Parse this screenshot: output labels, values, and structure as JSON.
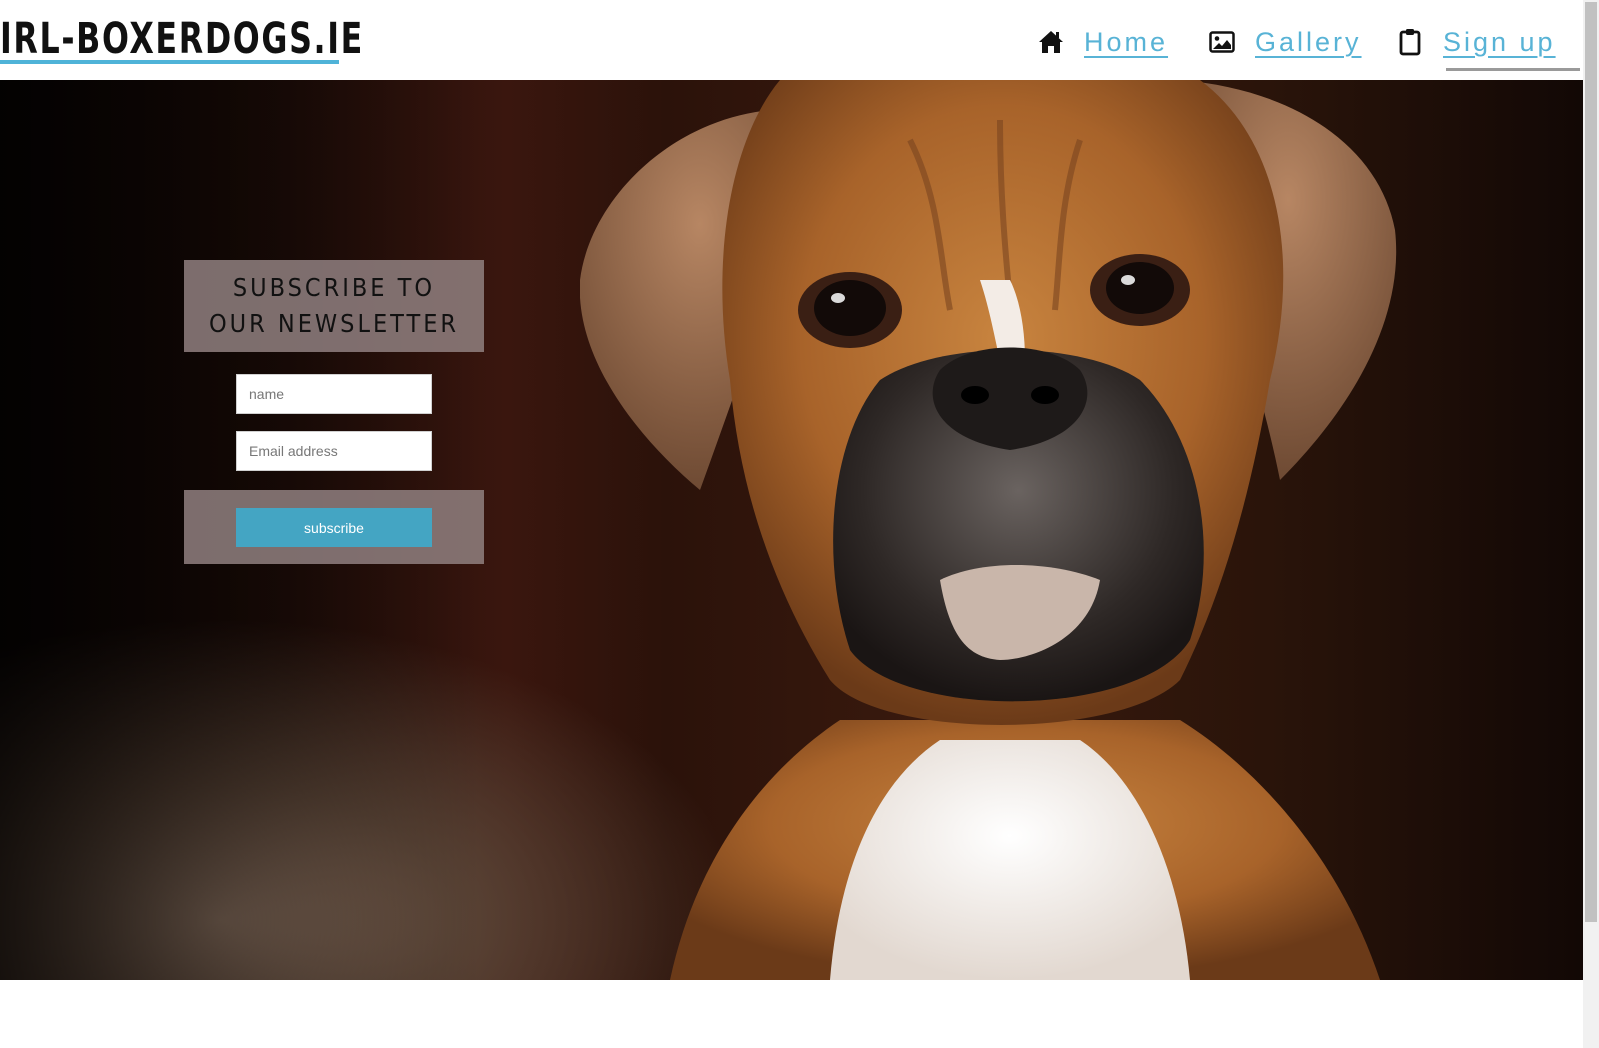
{
  "site": {
    "logo": "IRL-BOXERDOGS.IE",
    "accent_color": "#4fb3d8"
  },
  "nav": {
    "items": [
      {
        "label": "Home",
        "icon": "home-icon"
      },
      {
        "label": "Gallery",
        "icon": "image-icon"
      },
      {
        "label": "Sign up",
        "icon": "clipboard-icon",
        "active": true
      }
    ]
  },
  "hero": {
    "image": "boxer-dog-photo"
  },
  "newsletter": {
    "title": "SUBSCRIBE TO OUR NEWSLETTER",
    "name_placeholder": "name",
    "email_placeholder": "Email address",
    "button_label": "subscribe",
    "button_color": "#44a5c3"
  }
}
